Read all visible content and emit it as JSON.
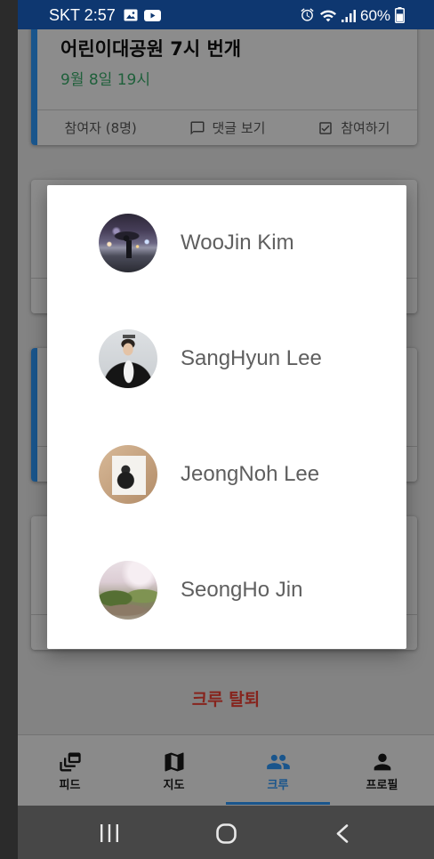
{
  "status_bar": {
    "carrier_time": "SKT 2:57",
    "battery_level": "60%",
    "left_icons": [
      "gallery-icon",
      "youtube-icon"
    ],
    "right_icons": [
      "alarm-icon",
      "wifi-icon",
      "signal-icon",
      "battery-icon"
    ]
  },
  "feed": {
    "cards": [
      {
        "title": "어린이대공원 7시 번개",
        "date": "9월 8일 19시",
        "highlighted": true,
        "actions": {
          "participants": "참여자 (8명)",
          "comments": "댓글 보기",
          "comments_icon": "comment-icon",
          "join": "참여하기",
          "join_icon": "checkbox-icon"
        }
      },
      {
        "highlighted": false
      },
      {
        "highlighted": true
      },
      {
        "highlighted": false
      }
    ]
  },
  "leave_crew_button": "크루 탈퇴",
  "bottom_nav": {
    "items": [
      {
        "label": "피드",
        "icon": "feed-icon",
        "active": false
      },
      {
        "label": "지도",
        "icon": "map-icon",
        "active": false
      },
      {
        "label": "크루",
        "icon": "crew-icon",
        "active": true
      },
      {
        "label": "프로필",
        "icon": "profile-icon",
        "active": false
      }
    ]
  },
  "member_dialog": {
    "members": [
      {
        "name": "WooJin Kim"
      },
      {
        "name": "SangHyun Lee"
      },
      {
        "name": "JeongNoh Lee"
      },
      {
        "name": "SeongHo Jin"
      }
    ]
  },
  "system_nav": {
    "icons": [
      "recent-apps-icon",
      "home-icon",
      "back-icon"
    ]
  },
  "colors": {
    "status_bar": "#0e3770",
    "accent": "#2f9bff",
    "date_text": "#3aaf6c",
    "danger": "#f44336",
    "scrim": "rgba(0,0,0,0.45)"
  }
}
